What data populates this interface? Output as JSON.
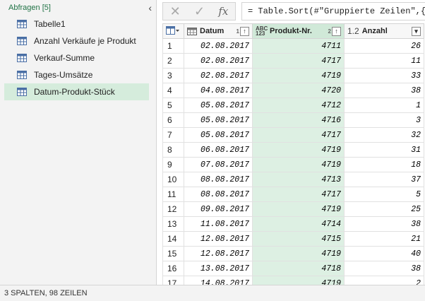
{
  "queries": {
    "title": "Abfragen [5]",
    "items": [
      {
        "label": "Tabelle1"
      },
      {
        "label": "Anzahl Verkäufe je Produkt"
      },
      {
        "label": "Verkauf-Summe"
      },
      {
        "label": "Tages-Umsätze"
      },
      {
        "label": "Datum-Produkt-Stück"
      }
    ]
  },
  "formula": {
    "text": "= Table.Sort(#\"Gruppierte Zeilen\",{{\"D"
  },
  "table": {
    "columns": [
      {
        "name": "Datum",
        "sort_order": "1"
      },
      {
        "name": "Produkt-Nr.",
        "type": "ABC 123",
        "sort_order": "2"
      },
      {
        "name": "Anzahl",
        "type": "1.2"
      }
    ],
    "rows": [
      [
        "1",
        "02.08.2017",
        "4711",
        "26"
      ],
      [
        "2",
        "02.08.2017",
        "4717",
        "11"
      ],
      [
        "3",
        "02.08.2017",
        "4719",
        "33"
      ],
      [
        "4",
        "04.08.2017",
        "4720",
        "38"
      ],
      [
        "5",
        "05.08.2017",
        "4712",
        "1"
      ],
      [
        "6",
        "05.08.2017",
        "4716",
        "3"
      ],
      [
        "7",
        "05.08.2017",
        "4717",
        "32"
      ],
      [
        "8",
        "06.08.2017",
        "4719",
        "31"
      ],
      [
        "9",
        "07.08.2017",
        "4719",
        "18"
      ],
      [
        "10",
        "08.08.2017",
        "4713",
        "37"
      ],
      [
        "11",
        "08.08.2017",
        "4717",
        "5"
      ],
      [
        "12",
        "09.08.2017",
        "4719",
        "25"
      ],
      [
        "13",
        "11.08.2017",
        "4714",
        "38"
      ],
      [
        "14",
        "12.08.2017",
        "4715",
        "21"
      ],
      [
        "15",
        "12.08.2017",
        "4719",
        "40"
      ],
      [
        "16",
        "13.08.2017",
        "4718",
        "38"
      ],
      [
        "17",
        "14.08.2017",
        "4719",
        "2"
      ]
    ]
  },
  "status": "3 SPALTEN, 98 ZEILEN",
  "colors": {
    "accent": "#217346",
    "selected": "#ddf0e3"
  }
}
